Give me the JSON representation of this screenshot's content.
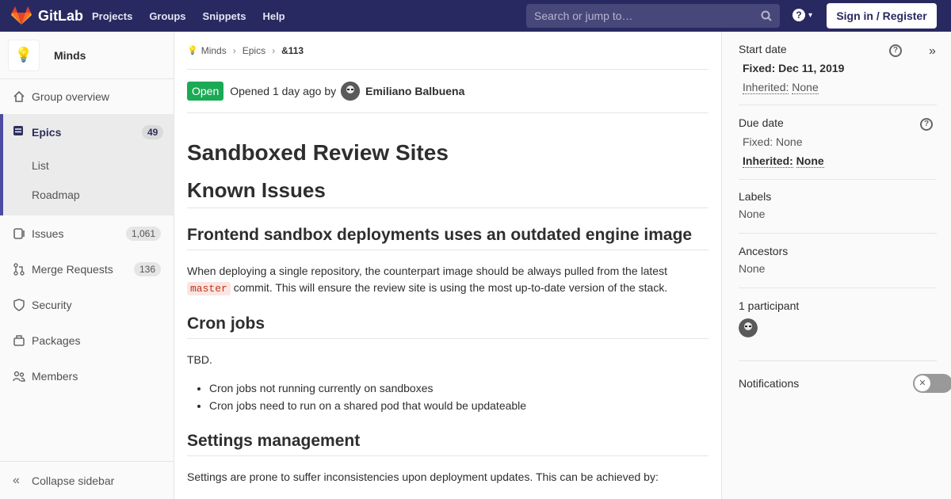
{
  "topbar": {
    "brand": "GitLab",
    "nav": [
      "Projects",
      "Groups",
      "Snippets",
      "Help"
    ],
    "search_placeholder": "Search or jump to…",
    "help_icon": "?",
    "signin_label": "Sign in / Register",
    "colors": {
      "navbar": "#292961",
      "logo_orange": "#fc6d26"
    }
  },
  "sidebar": {
    "group_name": "Minds",
    "group_avatar": "💡",
    "items": [
      {
        "label": "Group overview",
        "icon": "home-icon"
      },
      {
        "label": "Epics",
        "icon": "epic-icon",
        "badge": "49",
        "active": true
      },
      {
        "label": "Issues",
        "icon": "issues-icon",
        "badge": "1,061"
      },
      {
        "label": "Merge Requests",
        "icon": "merge-request-icon",
        "badge": "136"
      },
      {
        "label": "Security",
        "icon": "shield-icon"
      },
      {
        "label": "Packages",
        "icon": "package-icon"
      },
      {
        "label": "Members",
        "icon": "users-icon"
      }
    ],
    "epic_subitems": [
      "List",
      "Roadmap"
    ],
    "collapse_label": "Collapse sidebar"
  },
  "breadcrumb": [
    "Minds",
    "Epics",
    "&113"
  ],
  "epic": {
    "status": "Open",
    "opened_text": "Opened 1 day ago by",
    "author": "Emiliano Balbuena",
    "title": "Sandboxed Review Sites",
    "sections": {
      "known_issues": "Known Issues",
      "frontend_heading": "Frontend sandbox deployments uses an outdated engine image",
      "frontend_text_1": "When deploying a single repository, the counterpart image should be always pulled from the latest",
      "frontend_code": "master",
      "frontend_text_2": "commit. This will ensure the review site is using the most up-to-date version of the stack.",
      "cron_heading": "Cron jobs",
      "cron_text": "TBD.",
      "cron_items": [
        "Cron jobs not running currently on sandboxes",
        "Cron jobs need to run on a shared pod that would be updateable"
      ],
      "settings_heading": "Settings management",
      "settings_text": "Settings are prone to suffer inconsistencies upon deployment updates. This can be achieved by:"
    }
  },
  "right_sidebar": {
    "start_date": {
      "title": "Start date",
      "fixed_label": "Fixed:",
      "fixed_value": "Dec 11, 2019",
      "inherited_label": "Inherited:",
      "inherited_value": "None"
    },
    "due_date": {
      "title": "Due date",
      "fixed_label": "Fixed:",
      "fixed_value": "None",
      "inherited_label": "Inherited:",
      "inherited_value": "None"
    },
    "labels": {
      "title": "Labels",
      "value": "None"
    },
    "ancestors": {
      "title": "Ancestors",
      "value": "None"
    },
    "participants": {
      "title": "1 participant"
    },
    "notifications": {
      "title": "Notifications",
      "enabled": false
    },
    "collapse_icon": "»"
  }
}
